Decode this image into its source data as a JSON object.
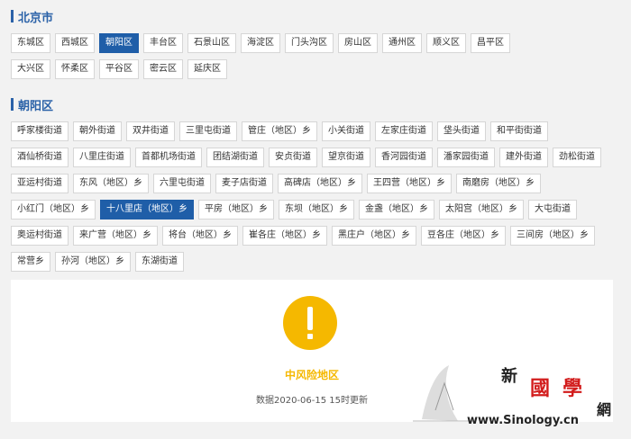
{
  "beijing": {
    "title": "北京市",
    "rows": [
      [
        "东城区",
        "西城区",
        "朝阳区",
        "丰台区",
        "石景山区",
        "海淀区",
        "门头沟区",
        "房山区",
        "通州区",
        "顺义区",
        "昌平区"
      ],
      [
        "大兴区",
        "怀柔区",
        "平谷区",
        "密云区",
        "延庆区"
      ]
    ],
    "active": "朝阳区"
  },
  "chaoyang": {
    "title": "朝阳区",
    "rows": [
      [
        "呼家楼街道",
        "朝外街道",
        "双井街道",
        "三里屯街道",
        "管庄（地区）乡",
        "小关街道",
        "左家庄街道",
        "垡头街道",
        "和平街街道"
      ],
      [
        "酒仙桥街道",
        "八里庄街道",
        "首都机场街道",
        "团结湖街道",
        "安贞街道",
        "望京街道",
        "香河园街道",
        "潘家园街道",
        "建外街道",
        "劲松街道"
      ],
      [
        "亚运村街道",
        "东风（地区）乡",
        "六里屯街道",
        "麦子店街道",
        "高碑店（地区）乡",
        "王四营（地区）乡",
        "南磨房（地区）乡"
      ],
      [
        "小红门（地区）乡",
        "十八里店（地区）乡",
        "平房（地区）乡",
        "东坝（地区）乡",
        "金盏（地区）乡",
        "太阳宫（地区）乡",
        "大屯街道"
      ],
      [
        "奥运村街道",
        "来广营（地区）乡",
        "将台（地区）乡",
        "崔各庄（地区）乡",
        "黑庄户（地区）乡",
        "豆各庄（地区）乡",
        "三间房（地区）乡"
      ],
      [
        "常营乡",
        "孙河（地区）乡",
        "东湖街道"
      ]
    ],
    "active": "十八里店（地区）乡"
  },
  "status": {
    "icon": "exclamation-icon",
    "color": "#f5b800",
    "label": "中风险地区",
    "updated": "数据2020-06-15 15时更新"
  },
  "watermark": {
    "chars": [
      "新",
      "國",
      "學",
      "網"
    ],
    "url": "www.Sinology.cn"
  }
}
